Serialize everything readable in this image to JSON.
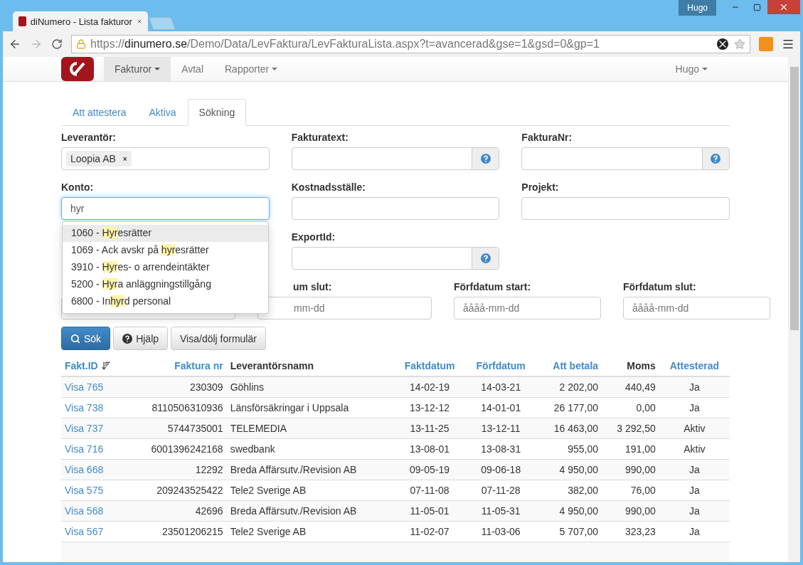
{
  "browser": {
    "user": "Hugo",
    "tab_title": "diNumero - Lista fakturor",
    "url_scheme": "https://",
    "url_host": "dinumero.se",
    "url_path": "/Demo/Data/LevFaktura/LevFakturaLista.aspx?t=avancerad&gse=1&gsd=0&gp=1"
  },
  "navbar": {
    "items": [
      {
        "label": "Fakturor",
        "selected": true,
        "dropdown": true
      },
      {
        "label": "Avtal",
        "selected": false,
        "dropdown": false
      },
      {
        "label": "Rapporter",
        "selected": false,
        "dropdown": true
      }
    ],
    "user": "Hugo"
  },
  "tabs": [
    {
      "label": "Att attestera",
      "selected": false
    },
    {
      "label": "Aktiva",
      "selected": false
    },
    {
      "label": "Sökning",
      "selected": true
    }
  ],
  "form_rows": [
    [
      {
        "label": "Leverantör:",
        "kind": "tags",
        "tags": [
          {
            "label": "Loopia AB",
            "remove": "×"
          }
        ]
      },
      {
        "label": "Fakturatext:",
        "kind": "help"
      },
      {
        "label": "FakturaNr:",
        "kind": "help"
      }
    ],
    [
      {
        "label": "Konto:",
        "kind": "text",
        "value": "hyr",
        "focused": true
      },
      {
        "label": "Kostnadsställe:",
        "kind": "text",
        "focused": false
      },
      {
        "label": "Projekt:",
        "kind": "text",
        "focused": false
      }
    ],
    [
      {
        "kind": "hidden"
      },
      {
        "label": "ExportId:",
        "kind": "help"
      },
      {
        "kind": "empty"
      }
    ]
  ],
  "date_fields": [
    {
      "covered": true
    },
    {
      "label": "um slut:",
      "placeholder": "mm-dd",
      "covered": true
    },
    {
      "label": "Förfdatum start:",
      "placeholder": "åååå-mm-dd",
      "covered": false
    },
    {
      "label": "Förfdatum slut:",
      "placeholder": "åååå-mm-dd",
      "covered": false
    }
  ],
  "suggestions": [
    {
      "before": "1060 - ",
      "match": "Hyr",
      "after": "esrätter",
      "selected": true
    },
    {
      "before": "1069 - Ack avskr på ",
      "match": "hyr",
      "after": "esrätter",
      "selected": false
    },
    {
      "before": "3910 - ",
      "match": "Hyr",
      "after": "es- o arrendeintäkter",
      "selected": false
    },
    {
      "before": "5200 - ",
      "match": "Hyr",
      "after": "a anläggningstillgång",
      "selected": false
    },
    {
      "before": "6800 - In",
      "match": "hyr",
      "after": "d personal",
      "selected": false
    }
  ],
  "buttons": [
    {
      "label": "Sök",
      "kind": "primary"
    },
    {
      "label": "Hjälp",
      "kind": "help"
    },
    {
      "label": "Visa/dölj formulär",
      "kind": "plain"
    }
  ],
  "table": {
    "columns": [
      {
        "label": "Fakt.ID",
        "sortable": true,
        "sorted": true
      },
      {
        "label": "Faktura nr",
        "sortable": true,
        "sorted": false
      },
      {
        "label": "Leverantörsnamn",
        "sortable": false,
        "sorted": false
      },
      {
        "label": "Faktdatum",
        "sortable": true,
        "sorted": false
      },
      {
        "label": "Förfdatum",
        "sortable": true,
        "sorted": false
      },
      {
        "label": "Att betala",
        "sortable": true,
        "sorted": false
      },
      {
        "label": "Moms",
        "sortable": false,
        "sorted": false
      },
      {
        "label": "Attesterad",
        "sortable": true,
        "sorted": false
      }
    ],
    "rows": [
      [
        "Visa 765",
        "230309",
        "Göhlins",
        "14-02-19",
        "14-03-21",
        "2 202,00",
        "440,49",
        "Ja"
      ],
      [
        "Visa 738",
        "8110506310936",
        "Länsförsäkringar i Uppsala",
        "13-12-12",
        "14-01-01",
        "26 177,00",
        "0,00",
        "Ja"
      ],
      [
        "Visa 737",
        "5744735001",
        "TELEMEDIA",
        "13-11-25",
        "13-12-11",
        "16 463,00",
        "3 292,50",
        "Aktiv"
      ],
      [
        "Visa 716",
        "6001396242168",
        "swedbank",
        "13-08-01",
        "13-08-31",
        "955,00",
        "191,00",
        "Aktiv"
      ],
      [
        "Visa 668",
        "12292",
        "Breda Affärsutv./Revision AB",
        "09-05-19",
        "09-06-18",
        "4 950,00",
        "990,00",
        "Ja"
      ],
      [
        "Visa 575",
        "209243525422",
        "Tele2 Sverige AB",
        "07-11-08",
        "07-11-28",
        "382,00",
        "76,00",
        "Ja"
      ],
      [
        "Visa 568",
        "42696",
        "Breda Affärsutv./Revision AB",
        "11-05-01",
        "11-05-31",
        "4 950,00",
        "990,00",
        "Ja"
      ],
      [
        "Visa 567",
        "23501206215",
        "Tele2 Sverige AB",
        "11-02-07",
        "11-03-06",
        "5 707,00",
        "323,23",
        "Ja"
      ]
    ]
  }
}
